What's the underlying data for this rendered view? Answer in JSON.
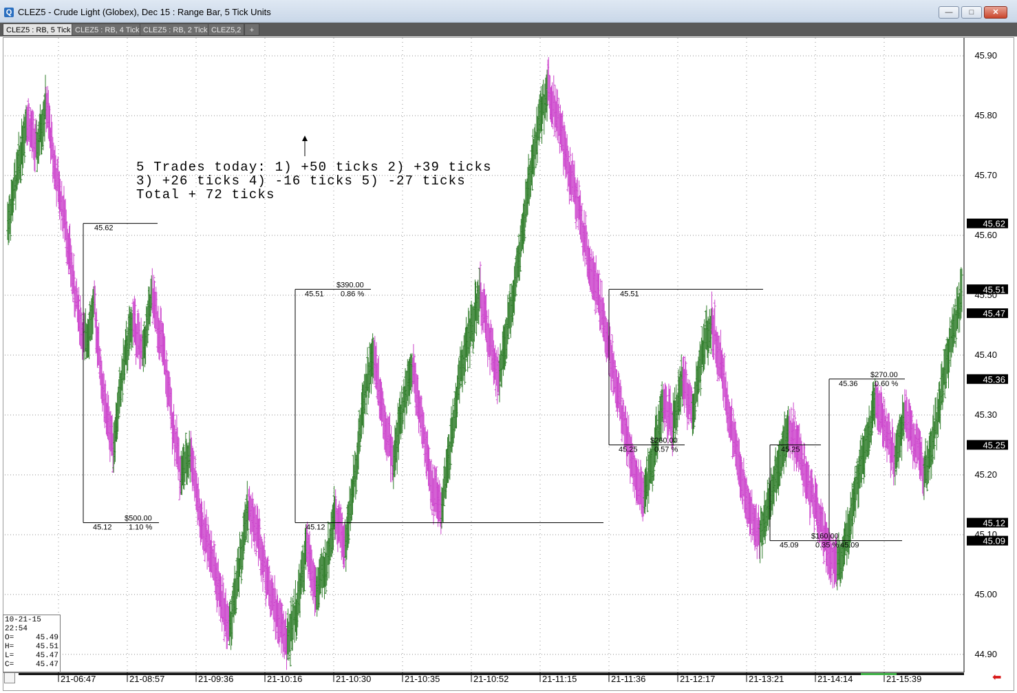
{
  "window": {
    "title": "CLEZ5 - Crude Light (Globex), Dec 15 : Range Bar, 5 Tick Units",
    "icon": "app-icon",
    "controls": [
      "minimize",
      "maximize",
      "close"
    ]
  },
  "tabs": [
    {
      "label": "CLEZ5 : RB, 5 Tick",
      "active": true
    },
    {
      "label": "CLEZ5 : RB, 4 Tick",
      "active": false
    },
    {
      "label": "CLEZ5 : RB, 2 Tick",
      "active": false
    },
    {
      "label": "CLEZ5,2",
      "active": false
    },
    {
      "label": "+",
      "active": false
    }
  ],
  "ohlc": {
    "date": "10-21-15",
    "time": "22:54",
    "rows": [
      {
        "label": "O=",
        "value": "45.49"
      },
      {
        "label": "H=",
        "value": "45.51"
      },
      {
        "label": "L=",
        "value": "45.47"
      },
      {
        "label": "C=",
        "value": "45.47"
      }
    ]
  },
  "annotation": {
    "lines": [
      "5 Trades today: 1) +50 ticks 2) +39 ticks",
      "3) +26 ticks 4) -16 ticks 5) -27 ticks",
      "Total + 72 ticks"
    ]
  },
  "colors": {
    "up_bar": "#2f7d2a",
    "down_bar": "#cc44cc",
    "price_badge_bg": "#000000",
    "price_badge_fg": "#ffffff",
    "grid": "#8c8c8c"
  },
  "chart_data": {
    "type": "line",
    "title": "",
    "xlabel": "",
    "ylabel": "",
    "ylim": [
      44.87,
      45.93
    ],
    "y_ticks": [
      "45.90",
      "45.80",
      "45.70",
      "45.60",
      "45.50",
      "45.40",
      "45.30",
      "45.20",
      "45.10",
      "45.00",
      "44.90"
    ],
    "x_ticks": [
      "21-06:47",
      "21-08:57",
      "21-09:36",
      "21-10:16",
      "21-10:30",
      "21-10:35",
      "21-10:52",
      "21-11:15",
      "21-11:36",
      "21-12:17",
      "21-13:21",
      "21-14:14",
      "21-15:39"
    ],
    "grid": true,
    "price_badges": [
      "45.62",
      "45.51",
      "45.47",
      "45.36",
      "45.25",
      "45.12",
      "45.09"
    ],
    "series": [
      {
        "values": [
          45.62,
          45.7,
          45.8,
          45.74,
          45.82,
          45.7,
          45.62,
          45.5,
          45.42,
          45.48,
          45.32,
          45.25,
          45.38,
          45.46,
          45.4,
          45.5,
          45.42,
          45.3,
          45.2,
          45.24,
          45.12,
          45.08,
          45.0,
          44.94,
          45.04,
          45.15,
          45.1,
          45.02,
          44.96,
          44.92,
          44.98,
          45.08,
          45.0,
          45.05,
          45.14,
          45.08,
          45.2,
          45.34,
          45.4,
          45.3,
          45.22,
          45.32,
          45.38,
          45.28,
          45.18,
          45.14,
          45.26,
          45.38,
          45.44,
          45.5,
          45.42,
          45.36,
          45.46,
          45.56,
          45.68,
          45.78,
          45.85,
          45.8,
          45.72,
          45.66,
          45.58,
          45.51,
          45.44,
          45.36,
          45.28,
          45.2,
          45.16,
          45.24,
          45.32,
          45.28,
          45.36,
          45.3,
          45.4,
          45.46,
          45.38,
          45.28,
          45.2,
          45.14,
          45.1,
          45.16,
          45.22,
          45.28,
          45.24,
          45.18,
          45.14,
          45.08,
          45.04,
          45.1,
          45.18,
          45.26,
          45.32,
          45.28,
          45.22,
          45.3,
          45.26,
          45.2,
          45.26,
          45.36,
          45.44,
          45.5
        ]
      }
    ],
    "trades": [
      {
        "entry": "45.62",
        "exit": "45.12",
        "pnl": "$500.00",
        "pct": "1.10 %"
      },
      {
        "entry": "45.12",
        "exit": "45.51",
        "pnl": "$390.00",
        "pct": "0.86 %"
      },
      {
        "entry": "45.51",
        "exit": "45.25",
        "pnl": "$260.00",
        "pct": "0.57 %"
      },
      {
        "entry": "45.25",
        "exit": "45.09",
        "pnl": "$160.00",
        "pct": "0.35 %"
      },
      {
        "entry": "45.09",
        "exit": "45.36",
        "pnl": "$270.00",
        "pct": "0.60 %"
      }
    ]
  }
}
